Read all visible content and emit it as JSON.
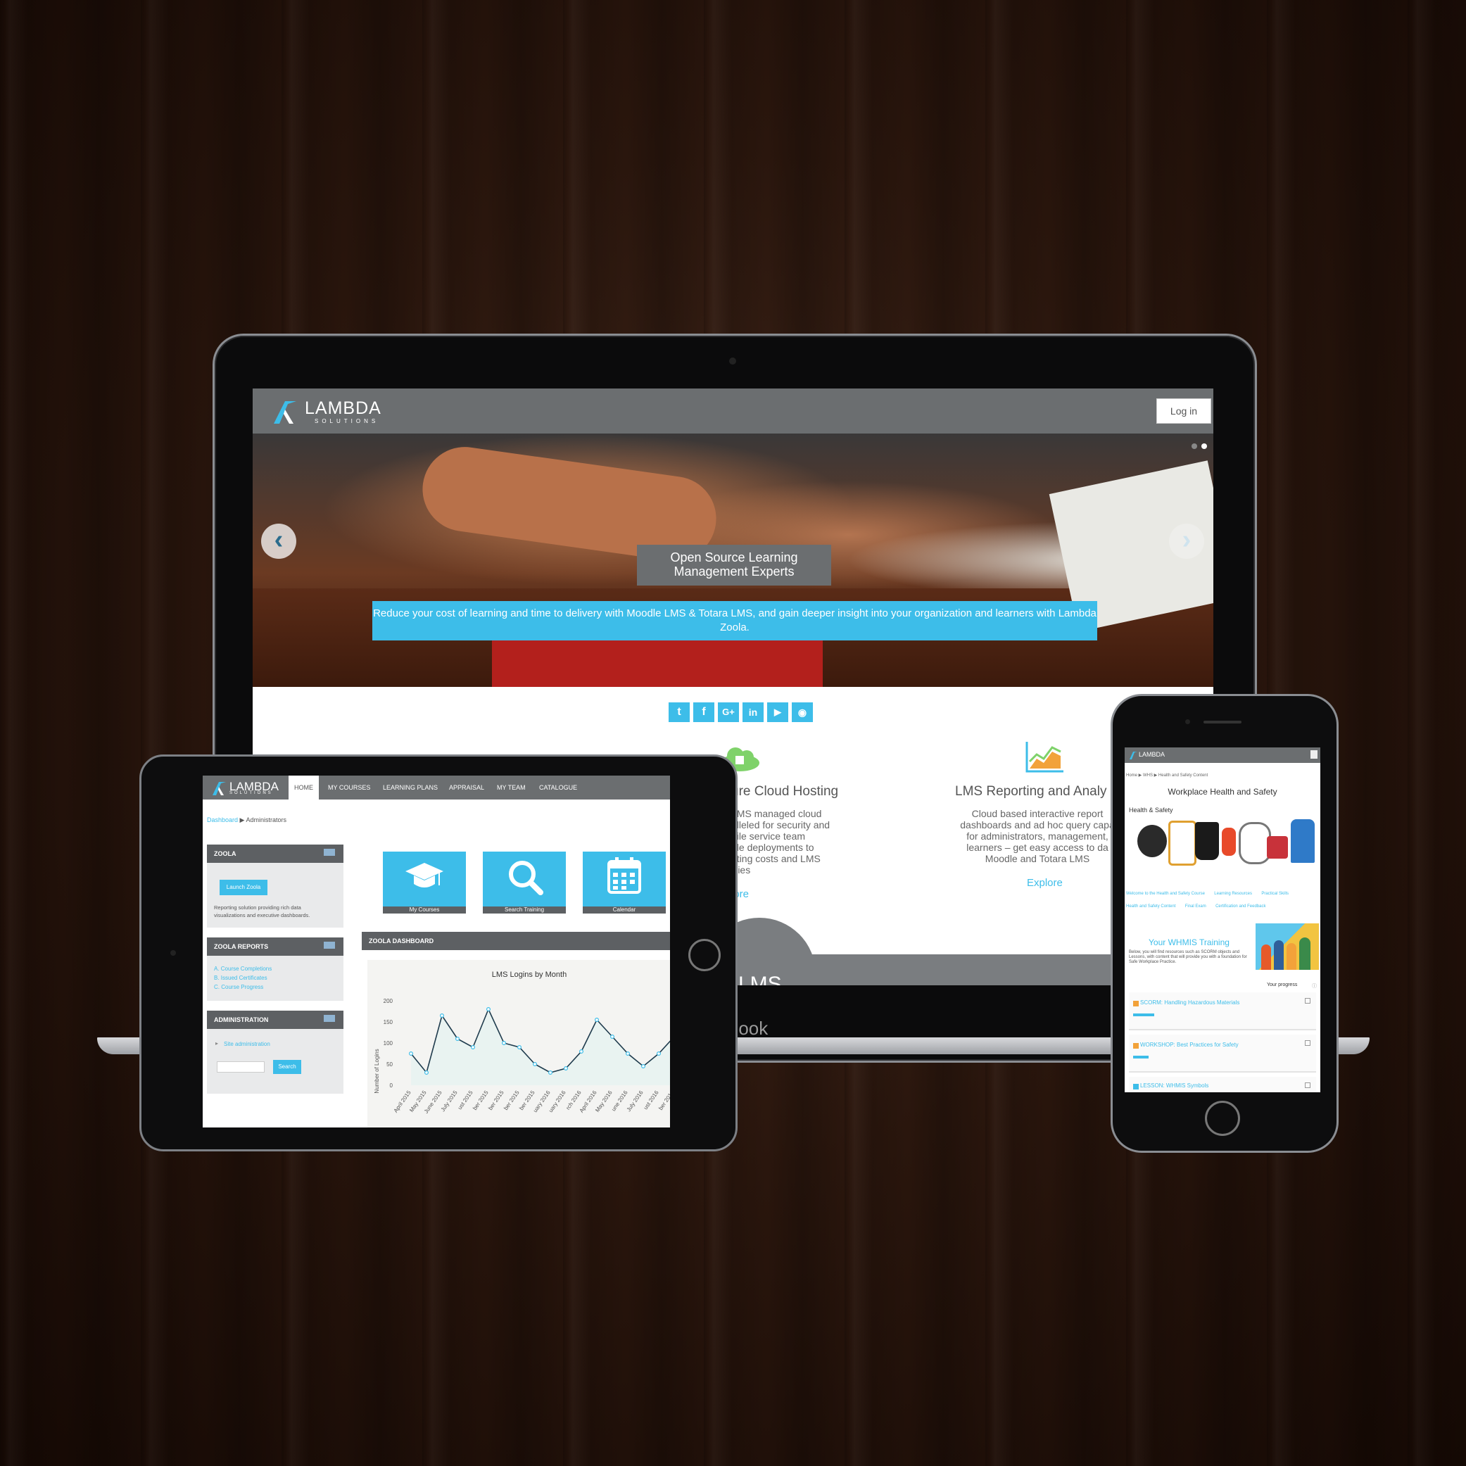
{
  "laptop": {
    "brand": "Book",
    "logo_text": "LAMBDA",
    "logo_sub": "SOLUTIONS",
    "login_label": "Log in",
    "hero_prev": "‹",
    "hero_next": "›",
    "hero_title_line1": "Open Source Learning",
    "hero_title_line2": "Management Experts",
    "hero_sub_line1": "Reduce your cost of learning and time to delivery with Moodle LMS & Totara LMS, and gain deeper insight into your organization and learners with Lambda",
    "hero_sub_line2": "Zoola.",
    "social": [
      "t",
      "f",
      "G+",
      "in",
      "▶",
      "◉"
    ],
    "feature_mid_title": "ure Cloud Hosting",
    "feature_mid_lines": [
      "LMS managed cloud",
      "alleled for security and",
      "gile service team",
      "ble deployments to",
      "ating costs and LMS",
      "rries"
    ],
    "feature_mid_link": "lore",
    "feature_right_title": "LMS Reporting and Analy",
    "feature_right_lines": [
      "Cloud based interactive report",
      "dashboards and ad hoc query capa",
      "for administrators, management,",
      "learners – get easy access to da",
      "Moodle and Totara LMS"
    ],
    "feature_right_link": "Explore",
    "bottom_partial": "LMS"
  },
  "tablet": {
    "logo_text": "LAMBDA",
    "logo_sub": "SOLUTIONS",
    "nav": [
      "HOME",
      "MY COURSES",
      "LEARNING PLANS",
      "APPRAISAL",
      "MY TEAM",
      "CATALOGUE"
    ],
    "breadcrumb_link": "Dashboard",
    "breadcrumb_sep": "▶",
    "breadcrumb_current": "Administrators",
    "zoola_title": "ZOOLA",
    "launch_label": "Launch Zoola",
    "zoola_desc_line1": "Reporting solution providing rich data",
    "zoola_desc_line2": "visualizations and executive dashboards.",
    "reports_title": "ZOOLA REPORTS",
    "reports": [
      "A. Course Completions",
      "B. Issued Certificates",
      "C. Course Progress"
    ],
    "admin_title": "ADMINISTRATION",
    "site_admin": "Site administration",
    "search_label": "Search",
    "buttons": [
      "My Courses",
      "Search Training",
      "Calendar"
    ],
    "dashboard_title": "ZOOLA DASHBOARD"
  },
  "chart_data": {
    "type": "line",
    "title": "LMS Logins by Month",
    "ylabel": "Number of Logins",
    "xlabel": "",
    "ylim": [
      0,
      200
    ],
    "yticks": [
      0,
      50,
      100,
      150,
      200
    ],
    "categories": [
      "April 2015",
      "May 2015",
      "June 2015",
      "July 2015",
      "August 2015",
      "September 2015",
      "October 2015",
      "November 2015",
      "December 2015",
      "January 2016",
      "February 2016",
      "March 2016",
      "April 2016",
      "May 2016",
      "June 2016",
      "July 2016",
      "August 2016",
      "September 2016",
      "October 2016"
    ],
    "tick_labels": [
      "April 2015",
      "May 2015",
      "June 2015",
      "July 2015",
      "ust 2015",
      "ber 2015",
      "ber 2015",
      "ber 2015",
      "ber 2015",
      "uary 2016",
      "uary 2016",
      "rch 2016",
      "April 2016",
      "May 2016",
      "une 2016",
      "July 2016",
      "ust 2016",
      "ber 2016",
      "ber 2"
    ],
    "values": [
      75,
      30,
      165,
      110,
      90,
      180,
      100,
      90,
      50,
      30,
      40,
      80,
      155,
      115,
      75,
      45,
      75,
      115,
      140
    ],
    "line_color": "#1f3b4d",
    "point_color": "#3dbde9",
    "fill_color": "#e9f3f1",
    "grid": false
  },
  "phone": {
    "logo_text": "LAMBDA",
    "breadcrumb": "Home ▶ WHS ▶ Health and Safety Content",
    "title": "Workplace Health and Safety",
    "section": "Health & Safety",
    "links_row1": [
      "Welcome to the Health and Safety Course",
      "Learning Resources",
      "Practical Skills"
    ],
    "links_row2": [
      "Health and Safety Content",
      "Final Exam",
      "Certification and Feedback"
    ],
    "training_title": "Your WHMIS Training",
    "training_desc": "Below, you will find resources such as SCORM objects and Lessons, with content that will provide you with a foundation for Safe Workplace Practice.",
    "progress_label": "Your progress",
    "items": [
      "SCORM: Handling Hazardous Materials",
      "WORKSHOP: Best Practices for Safety",
      "LESSON: WHMIS Symbols"
    ]
  },
  "colors": {
    "accent": "#3dbde9",
    "header_gray": "#6b6e70",
    "panel_dark": "#5d6063"
  }
}
